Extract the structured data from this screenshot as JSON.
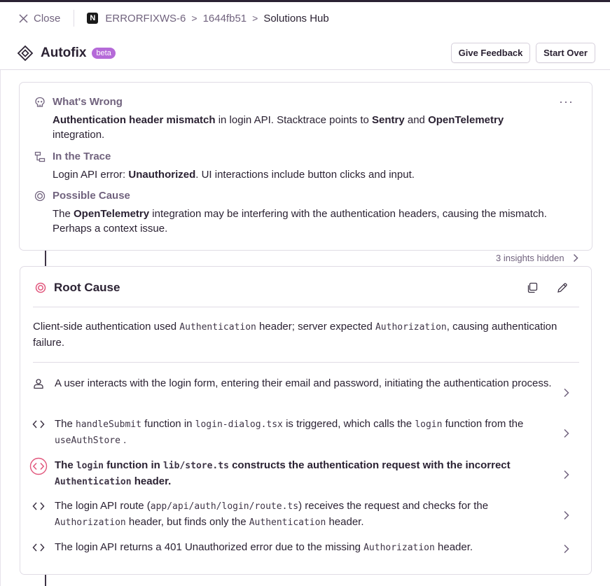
{
  "topbar": {
    "close_label": "Close",
    "project_icon_letter": "N",
    "breadcrumbs": [
      "ERRORFIXWS-6",
      "1644fb51",
      "Solutions Hub"
    ]
  },
  "header": {
    "title": "Autofix",
    "badge": "beta",
    "feedback_label": "Give Feedback",
    "start_over_label": "Start Over"
  },
  "insights": {
    "whats_wrong": {
      "title": "What's Wrong",
      "parts": [
        "Authentication header mismatch",
        " in login API. Stacktrace points to ",
        "Sentry",
        " and ",
        "OpenTelemetry",
        " integration."
      ]
    },
    "in_trace": {
      "title": "In the Trace",
      "parts": [
        "Login API error: ",
        "Unauthorized",
        ". UI interactions include button clicks and input."
      ]
    },
    "possible_cause": {
      "title": "Possible Cause",
      "parts": [
        "The ",
        "OpenTelemetry",
        " integration may be interfering with the authentication headers, causing the mismatch. Perhaps a context issue."
      ]
    },
    "hidden_label": "3 insights hidden"
  },
  "root_cause": {
    "title": "Root Cause",
    "summary": {
      "t1": "Client-side authentication used ",
      "c1": "Authentication",
      "t2": " header; server expected ",
      "c2": "Authorization",
      "t3": ", causing authentication failure."
    },
    "steps": [
      {
        "t1": "A user interacts with the login form, entering their email and password, initiating the authentication process."
      },
      {
        "t1": "The ",
        "c1": "handleSubmit",
        "t2": " function in ",
        "c2": "login-dialog.tsx",
        "t3": " is triggered, which calls the ",
        "c3": "login",
        "t4": " function from the ",
        "c4": "useAuthStore",
        "t5": "."
      },
      {
        "t1": "The ",
        "c1": "login",
        "t2": " function in ",
        "c2": "lib/store.ts",
        "t3": " constructs the authentication request with the incorrect ",
        "c3": "Authentication",
        "t4": " header."
      },
      {
        "t1": "The login API route (",
        "c1": "app/api/auth/login/route.ts",
        "t2": ") receives the request and checks for the ",
        "c2": "Authorization",
        "t3": " header, but finds only the ",
        "c3": "Authentication",
        "t4": " header."
      },
      {
        "t1": "The login API returns a 401 Unauthorized error due to the missing ",
        "c1": "Authorization",
        "t2": " header."
      }
    ]
  },
  "colors": {
    "accent_purple": "#b56ad8",
    "highlight_red": "#e1567c",
    "muted_text": "#71637e"
  }
}
